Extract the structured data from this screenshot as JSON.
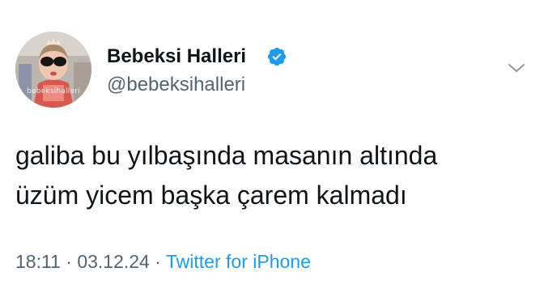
{
  "author": {
    "display_name": "Bebeksi Halleri",
    "handle": "@bebeksihalleri",
    "avatar_watermark": "bebeksihalleri",
    "verified": true,
    "verified_color": "#1d9bf0"
  },
  "tweet": {
    "lines": [
      "galiba bu yılbaşında masanın altında",
      "üzüm yicem başka çarem kalmadı"
    ]
  },
  "meta": {
    "time": "18:11",
    "separator": "·",
    "date": "03.12.24",
    "source": "Twitter for iPhone",
    "source_color": "#1d9bf0"
  },
  "icons": {
    "verified": "verified-badge-icon",
    "menu": "chevron-down-icon"
  }
}
